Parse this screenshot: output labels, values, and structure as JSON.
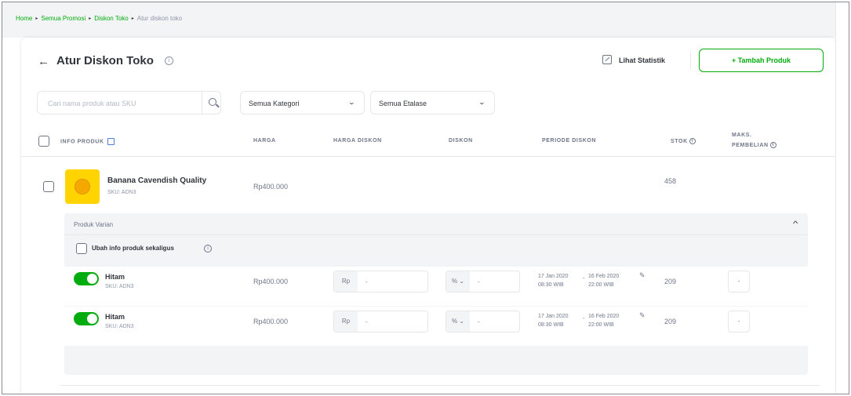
{
  "breadcrumb": {
    "items": [
      "Home",
      "Semua Promosi",
      "Diskon Toko",
      "Atur diskon toko"
    ],
    "separator": "▸"
  },
  "header": {
    "title": "Atur Diskon Toko",
    "back_icon": "←",
    "info_icon": "i",
    "stats_label": "Lihat Statistik",
    "add_button": "+ Tambah Produk"
  },
  "filters": {
    "search_placeholder": "Cari nama produk atau SKU",
    "category_label": "Semua Kategori",
    "etalase_label": "Semua Etalase",
    "chevron": "⌄"
  },
  "table": {
    "headers": {
      "info_produk": "INFO PRODUK",
      "harga": "HARGA",
      "harga_diskon": "HARGA DISKON",
      "diskon": "DISKON",
      "periode": "PERIODE DISKON",
      "stok": "STOK",
      "maks_1": "MAKS.",
      "maks_2": "PEMBELIAN"
    }
  },
  "product": {
    "name": "Banana Cavendish Quality",
    "sku": "SKU: ADN3",
    "price": "Rp400.000",
    "stock": "458"
  },
  "variants": {
    "panel_title": "Produk Varian",
    "collapse_icon": "^",
    "bulk_edit_label": "Ubah info produk sekaligus",
    "rows": [
      {
        "name": "Hitam",
        "sku": "SKU: ADN3",
        "price": "Rp400.000",
        "discount_price_prefix": "Rp",
        "discount_price_value": "-",
        "discount_type": "% ⌄",
        "discount_value": "-",
        "start_date": "17 Jan 2020",
        "start_time": "08:30 WIB",
        "dash": "-",
        "end_date": "16 Feb 2020",
        "end_time": "22:00 WIB",
        "edit_icon": "✎",
        "stock": "209",
        "max_purchase": "-"
      },
      {
        "name": "Hitam",
        "sku": "SKU: ADN3",
        "price": "Rp400.000",
        "discount_price_prefix": "Rp",
        "discount_price_value": "-",
        "discount_type": "% ⌄",
        "discount_value": "-",
        "start_date": "17 Jan 2020",
        "start_time": "08:30 WIB",
        "dash": "-",
        "end_date": "16 Feb 2020",
        "end_time": "22:00 WIB",
        "edit_icon": "✎",
        "stock": "209",
        "max_purchase": "-"
      }
    ]
  },
  "colors": {
    "accent_green": "#03ac0e",
    "text_dark": "#31353b",
    "text_muted": "#6d7588",
    "product_yellow": "#ffd400"
  }
}
